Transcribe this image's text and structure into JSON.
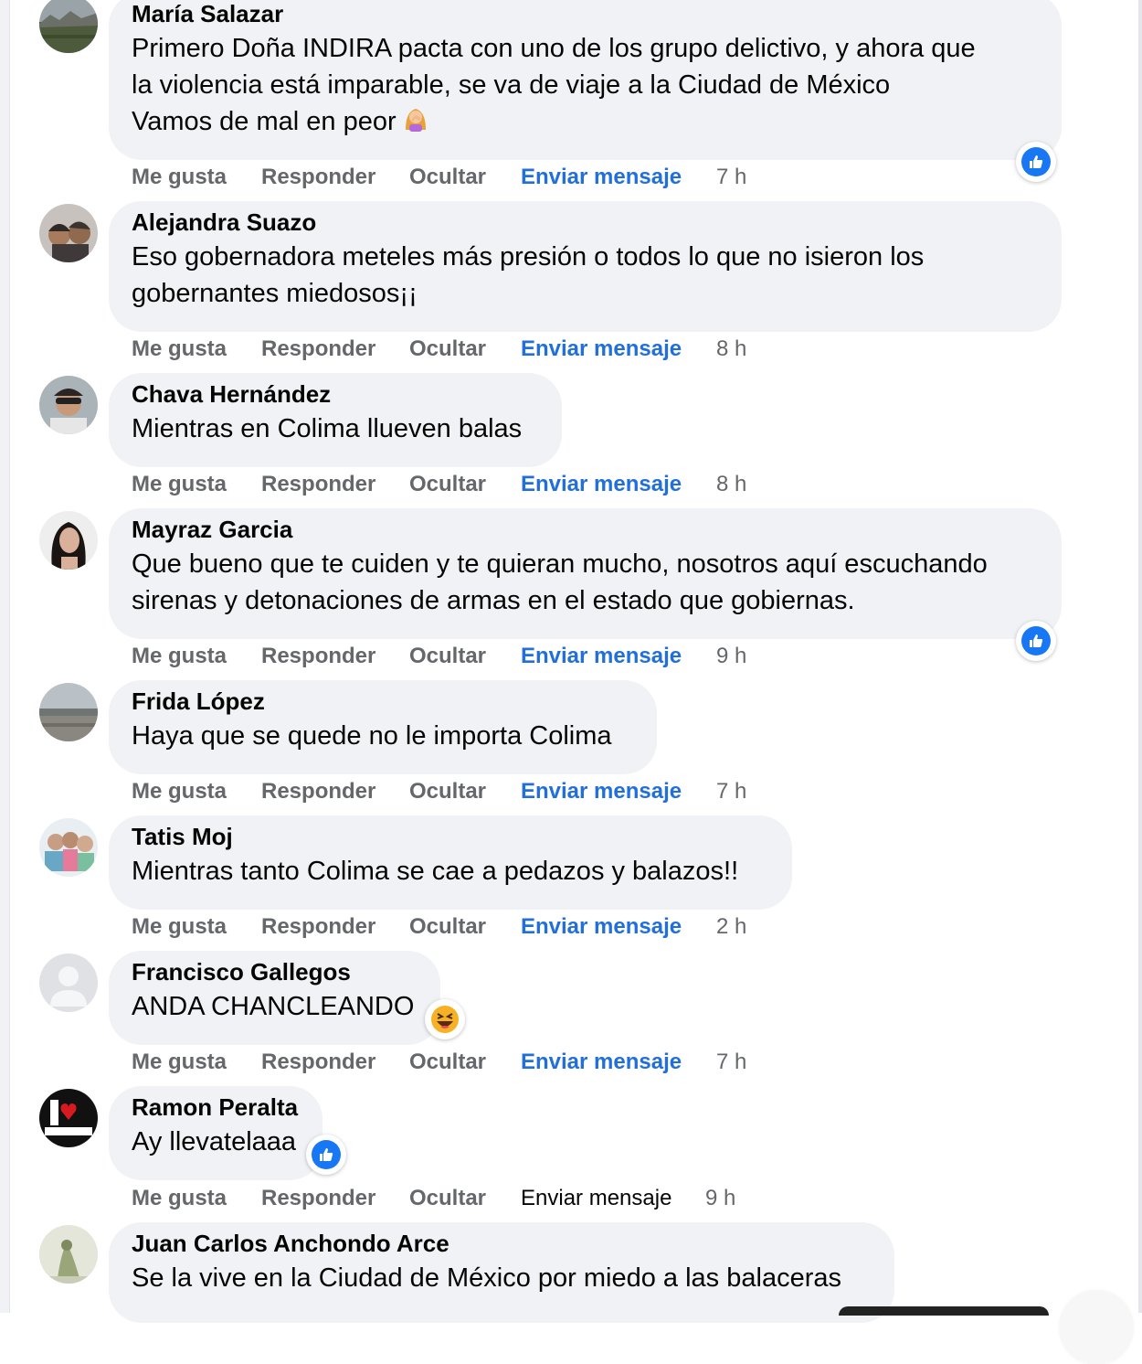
{
  "actions": {
    "like": "Me gusta",
    "reply": "Responder",
    "hide": "Ocultar",
    "message": "Enviar mensaje"
  },
  "colors": {
    "bubble": "#f0f2f5",
    "link_blue": "#216fdb",
    "muted": "#65676b",
    "like_blue": "#1877f2"
  },
  "comments": [
    {
      "author": "María Salazar",
      "lines": [
        "Primero Doña INDIRA pacta con uno de los grupo delictivo, y ahora que",
        "la violencia está imparable, se va de viaje a la Ciudad de México",
        "Vamos de mal en peor"
      ],
      "emoji": "woman-facepalming",
      "time": "7 h",
      "reaction": "like"
    },
    {
      "author": "Alejandra Suazo",
      "lines": [
        "Eso gobernadora meteles más presión o todos lo que no isieron los",
        "gobernantes miedosos¡¡"
      ],
      "time": "8 h"
    },
    {
      "author": "Chava Hernández",
      "lines": [
        "Mientras en Colima llueven balas"
      ],
      "time": "8 h"
    },
    {
      "author": "Mayraz Garcia",
      "lines": [
        "Que bueno que te cuiden y te quieran mucho, nosotros aquí escuchando",
        "sirenas y detonaciones de armas en el estado que gobiernas."
      ],
      "time": "9 h",
      "reaction": "like"
    },
    {
      "author": "Frida López",
      "lines": [
        "Haya que se quede no le importa Colima"
      ],
      "time": "7 h"
    },
    {
      "author": "Tatis Moj",
      "lines": [
        "Mientras tanto Colima se cae a pedazos y balazos!!"
      ],
      "time": "2 h"
    },
    {
      "author": "Francisco Gallegos",
      "lines": [
        "ANDA CHANCLEANDO"
      ],
      "time": "7 h",
      "reaction": "haha"
    },
    {
      "author": "Ramon Peralta",
      "lines": [
        "Ay llevatelaaa"
      ],
      "time": "9 h",
      "reaction": "like"
    },
    {
      "author": "Juan Carlos Anchondo Arce",
      "lines": [
        "Se la vive en la Ciudad de México por miedo a las balaceras"
      ]
    }
  ]
}
